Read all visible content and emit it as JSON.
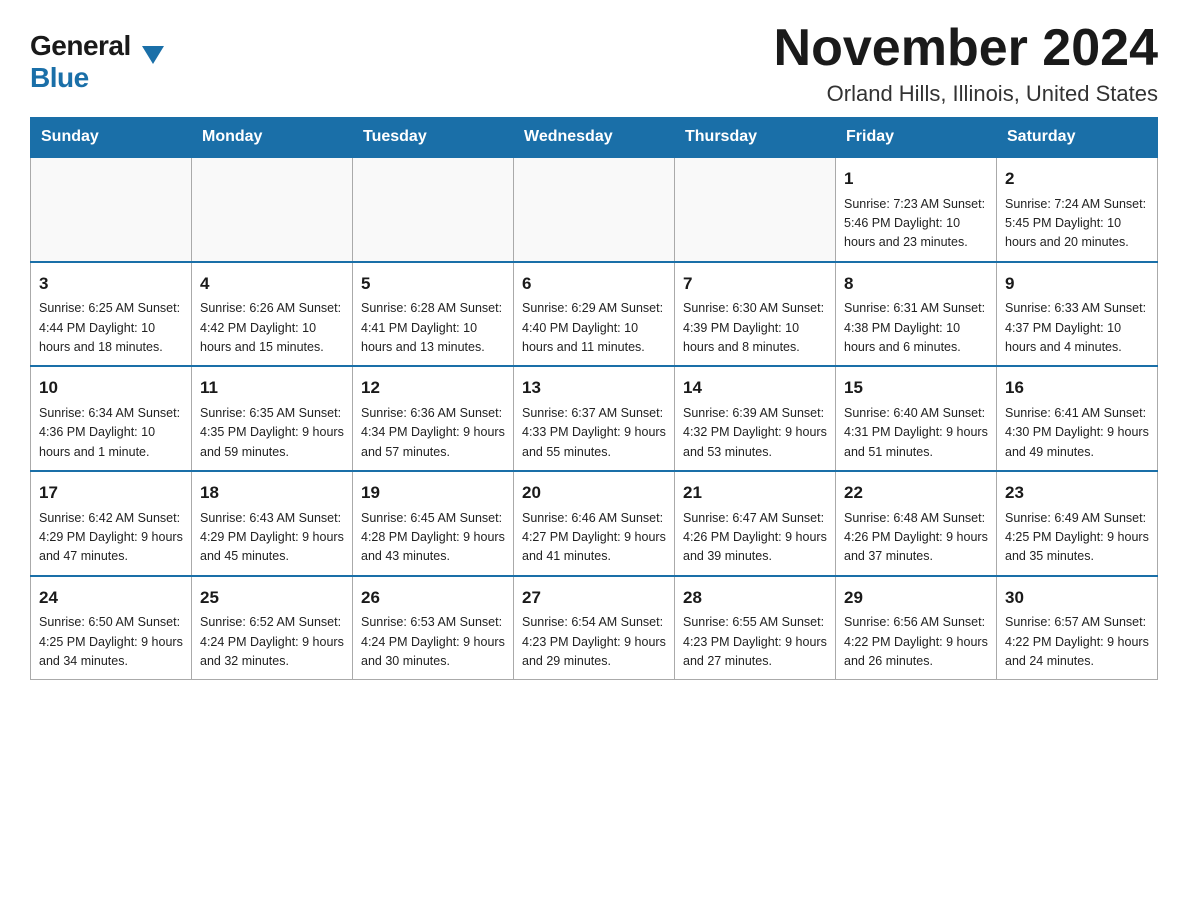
{
  "header": {
    "logo_general": "General",
    "logo_blue": "Blue",
    "month_title": "November 2024",
    "location": "Orland Hills, Illinois, United States"
  },
  "days_of_week": [
    "Sunday",
    "Monday",
    "Tuesday",
    "Wednesday",
    "Thursday",
    "Friday",
    "Saturday"
  ],
  "weeks": [
    {
      "days": [
        {
          "number": "",
          "info": ""
        },
        {
          "number": "",
          "info": ""
        },
        {
          "number": "",
          "info": ""
        },
        {
          "number": "",
          "info": ""
        },
        {
          "number": "",
          "info": ""
        },
        {
          "number": "1",
          "info": "Sunrise: 7:23 AM\nSunset: 5:46 PM\nDaylight: 10 hours and 23 minutes."
        },
        {
          "number": "2",
          "info": "Sunrise: 7:24 AM\nSunset: 5:45 PM\nDaylight: 10 hours and 20 minutes."
        }
      ]
    },
    {
      "days": [
        {
          "number": "3",
          "info": "Sunrise: 6:25 AM\nSunset: 4:44 PM\nDaylight: 10 hours and 18 minutes."
        },
        {
          "number": "4",
          "info": "Sunrise: 6:26 AM\nSunset: 4:42 PM\nDaylight: 10 hours and 15 minutes."
        },
        {
          "number": "5",
          "info": "Sunrise: 6:28 AM\nSunset: 4:41 PM\nDaylight: 10 hours and 13 minutes."
        },
        {
          "number": "6",
          "info": "Sunrise: 6:29 AM\nSunset: 4:40 PM\nDaylight: 10 hours and 11 minutes."
        },
        {
          "number": "7",
          "info": "Sunrise: 6:30 AM\nSunset: 4:39 PM\nDaylight: 10 hours and 8 minutes."
        },
        {
          "number": "8",
          "info": "Sunrise: 6:31 AM\nSunset: 4:38 PM\nDaylight: 10 hours and 6 minutes."
        },
        {
          "number": "9",
          "info": "Sunrise: 6:33 AM\nSunset: 4:37 PM\nDaylight: 10 hours and 4 minutes."
        }
      ]
    },
    {
      "days": [
        {
          "number": "10",
          "info": "Sunrise: 6:34 AM\nSunset: 4:36 PM\nDaylight: 10 hours and 1 minute."
        },
        {
          "number": "11",
          "info": "Sunrise: 6:35 AM\nSunset: 4:35 PM\nDaylight: 9 hours and 59 minutes."
        },
        {
          "number": "12",
          "info": "Sunrise: 6:36 AM\nSunset: 4:34 PM\nDaylight: 9 hours and 57 minutes."
        },
        {
          "number": "13",
          "info": "Sunrise: 6:37 AM\nSunset: 4:33 PM\nDaylight: 9 hours and 55 minutes."
        },
        {
          "number": "14",
          "info": "Sunrise: 6:39 AM\nSunset: 4:32 PM\nDaylight: 9 hours and 53 minutes."
        },
        {
          "number": "15",
          "info": "Sunrise: 6:40 AM\nSunset: 4:31 PM\nDaylight: 9 hours and 51 minutes."
        },
        {
          "number": "16",
          "info": "Sunrise: 6:41 AM\nSunset: 4:30 PM\nDaylight: 9 hours and 49 minutes."
        }
      ]
    },
    {
      "days": [
        {
          "number": "17",
          "info": "Sunrise: 6:42 AM\nSunset: 4:29 PM\nDaylight: 9 hours and 47 minutes."
        },
        {
          "number": "18",
          "info": "Sunrise: 6:43 AM\nSunset: 4:29 PM\nDaylight: 9 hours and 45 minutes."
        },
        {
          "number": "19",
          "info": "Sunrise: 6:45 AM\nSunset: 4:28 PM\nDaylight: 9 hours and 43 minutes."
        },
        {
          "number": "20",
          "info": "Sunrise: 6:46 AM\nSunset: 4:27 PM\nDaylight: 9 hours and 41 minutes."
        },
        {
          "number": "21",
          "info": "Sunrise: 6:47 AM\nSunset: 4:26 PM\nDaylight: 9 hours and 39 minutes."
        },
        {
          "number": "22",
          "info": "Sunrise: 6:48 AM\nSunset: 4:26 PM\nDaylight: 9 hours and 37 minutes."
        },
        {
          "number": "23",
          "info": "Sunrise: 6:49 AM\nSunset: 4:25 PM\nDaylight: 9 hours and 35 minutes."
        }
      ]
    },
    {
      "days": [
        {
          "number": "24",
          "info": "Sunrise: 6:50 AM\nSunset: 4:25 PM\nDaylight: 9 hours and 34 minutes."
        },
        {
          "number": "25",
          "info": "Sunrise: 6:52 AM\nSunset: 4:24 PM\nDaylight: 9 hours and 32 minutes."
        },
        {
          "number": "26",
          "info": "Sunrise: 6:53 AM\nSunset: 4:24 PM\nDaylight: 9 hours and 30 minutes."
        },
        {
          "number": "27",
          "info": "Sunrise: 6:54 AM\nSunset: 4:23 PM\nDaylight: 9 hours and 29 minutes."
        },
        {
          "number": "28",
          "info": "Sunrise: 6:55 AM\nSunset: 4:23 PM\nDaylight: 9 hours and 27 minutes."
        },
        {
          "number": "29",
          "info": "Sunrise: 6:56 AM\nSunset: 4:22 PM\nDaylight: 9 hours and 26 minutes."
        },
        {
          "number": "30",
          "info": "Sunrise: 6:57 AM\nSunset: 4:22 PM\nDaylight: 9 hours and 24 minutes."
        }
      ]
    }
  ]
}
